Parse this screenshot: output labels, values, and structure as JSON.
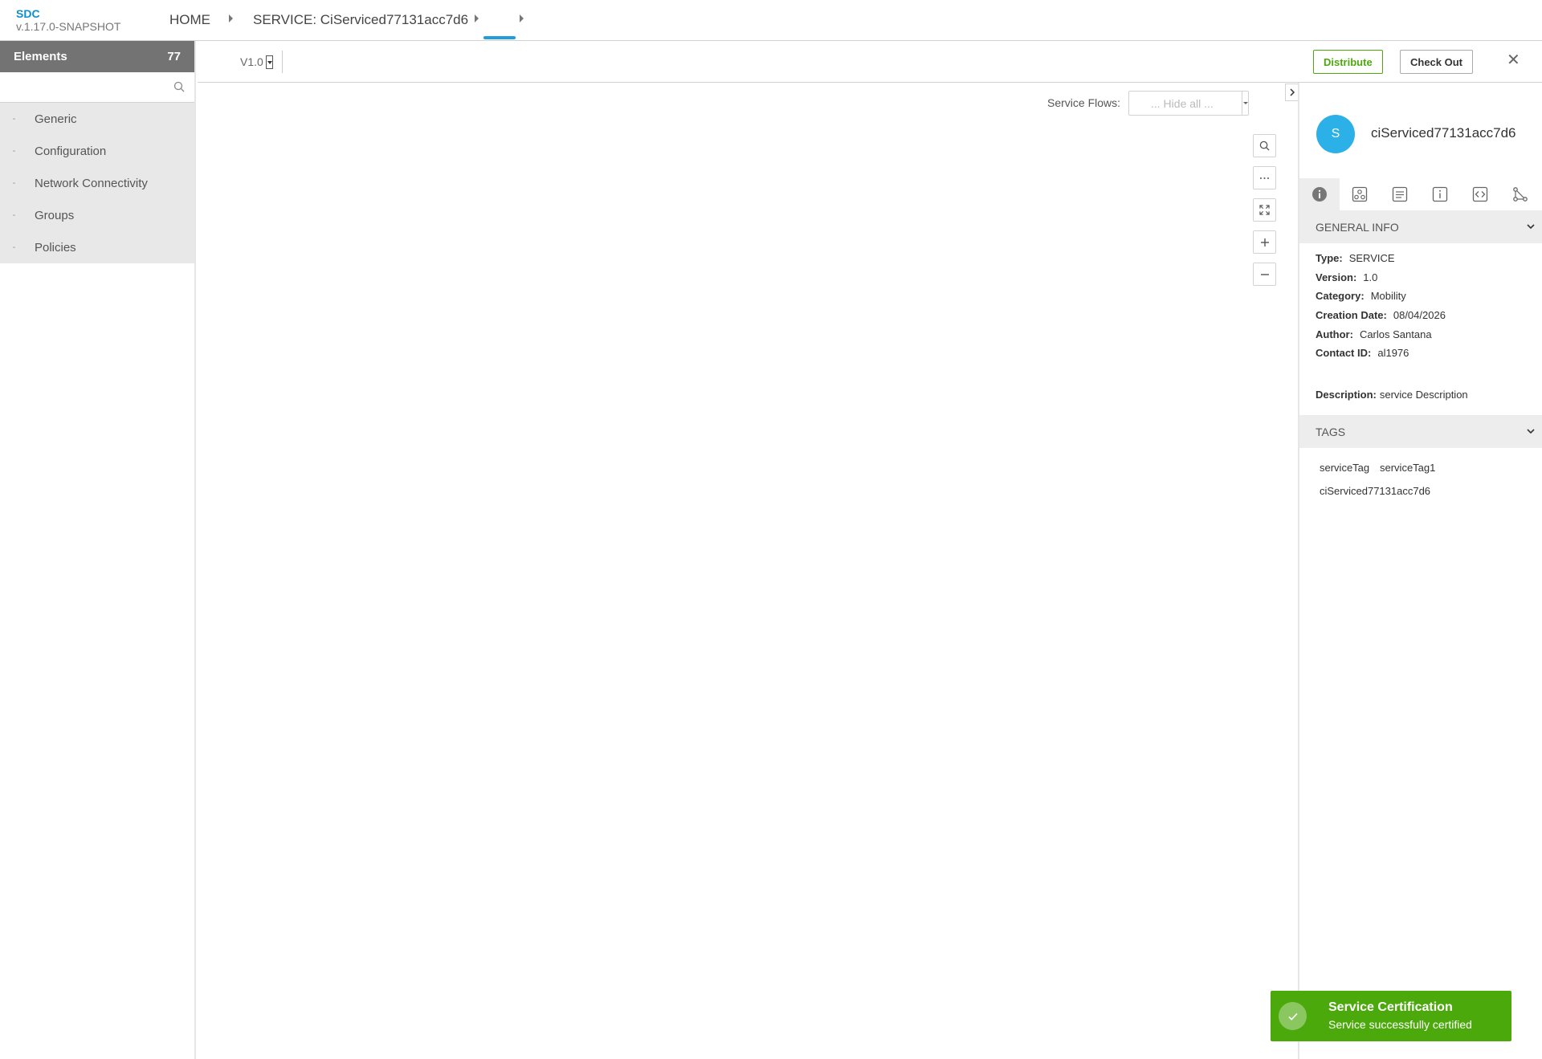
{
  "brand": {
    "name": "SDC",
    "version": "v.1.17.0-SNAPSHOT"
  },
  "breadcrumb": {
    "home": "HOME",
    "service": "SERVICE: CiServiced77131acc7d6"
  },
  "palette": {
    "title": "Elements",
    "count": "77",
    "search_placeholder": "",
    "groups": [
      {
        "label": "Generic"
      },
      {
        "label": "Configuration"
      },
      {
        "label": "Network Connectivity"
      },
      {
        "label": "Groups"
      },
      {
        "label": "Policies"
      }
    ]
  },
  "toolbar": {
    "version": "V1.0",
    "distribute_label": "Distribute",
    "checkout_label": "Check Out",
    "close_label": "✕"
  },
  "canvas": {
    "service_flows_label": "Service Flows:",
    "service_flows_value": "... Hide all ..."
  },
  "panel": {
    "avatar_letter": "S",
    "title": "ciServiced77131acc7d6",
    "general_info_title": "GENERAL INFO",
    "info": [
      {
        "label": "Type:",
        "value": "SERVICE"
      },
      {
        "label": "Version:",
        "value": "1.0"
      },
      {
        "label": "Category:",
        "value": "Mobility"
      },
      {
        "label": "Creation Date:",
        "value": "08/04/2026"
      },
      {
        "label": "Author:",
        "value": "Carlos Santana"
      },
      {
        "label": "Contact ID:",
        "value": "al1976"
      }
    ],
    "description_label": "Description:",
    "description_value": "service Description",
    "tags_title": "TAGS",
    "tags": [
      "serviceTag",
      "serviceTag1",
      "ciServiced77131acc7d6"
    ]
  },
  "toast": {
    "title": "Service Certification",
    "message": "Service successfully certified"
  },
  "colors": {
    "accent": "#1f9ddc",
    "success": "#4ca90c",
    "avatar": "#2cb0e8",
    "palette_header": "#737373"
  }
}
